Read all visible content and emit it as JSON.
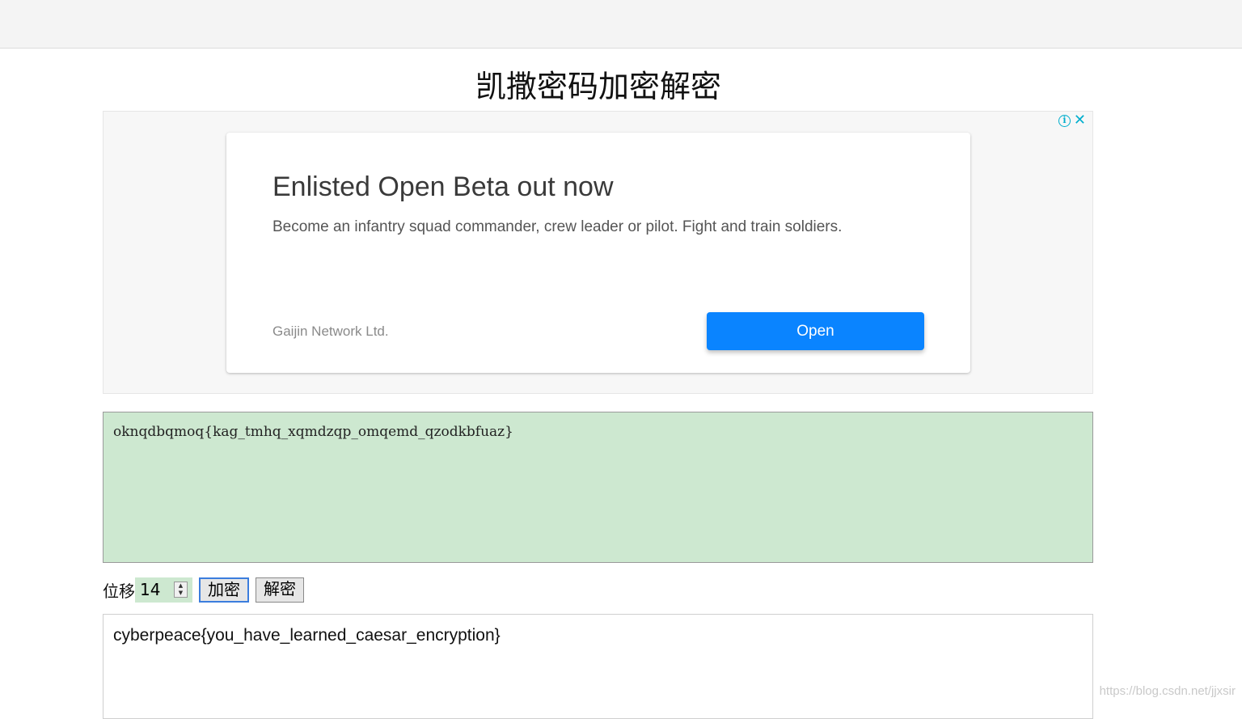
{
  "page": {
    "title": "凯撒密码加密解密"
  },
  "ad": {
    "headline": "Enlisted Open Beta out now",
    "body": "Become an infantry squad commander, crew leader or pilot. Fight and train soldiers.",
    "advertiser": "Gaijin Network Ltd.",
    "button_label": "Open",
    "info_icon": "i",
    "close_icon": "✕",
    "accent_color": "#0a84ff"
  },
  "cipher": {
    "text": "oknqdbqmoq{kag_tmhq_xqmdzqp_omqemd_qzodkbfuaz}"
  },
  "controls": {
    "shift_label": "位移",
    "shift_value": "14",
    "encrypt_label": "加密",
    "decrypt_label": "解密"
  },
  "plain": {
    "text": "cyberpeace{you_have_learned_caesar_encryption}"
  },
  "watermark": "https://blog.csdn.net/jjxsir"
}
